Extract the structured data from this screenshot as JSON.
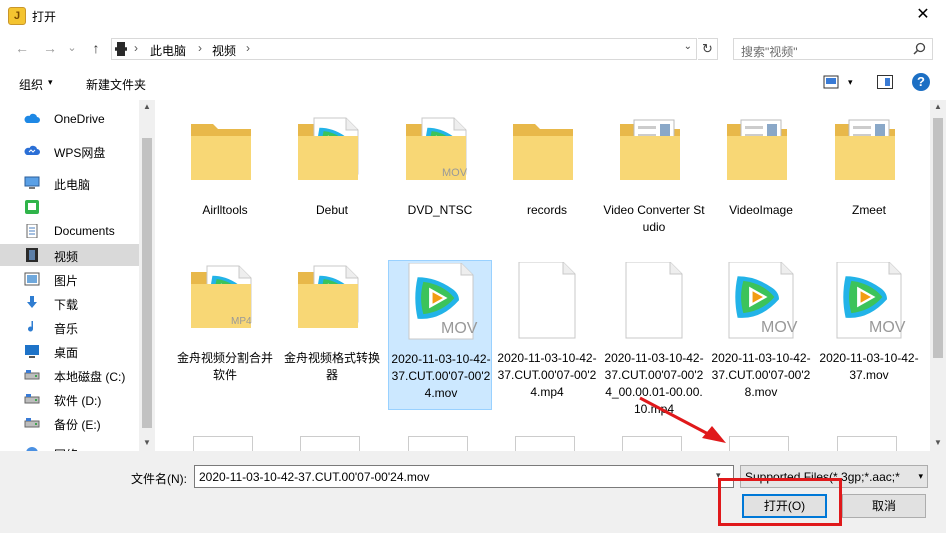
{
  "window": {
    "title": "打开",
    "close": "✕"
  },
  "nav": {
    "back": "←",
    "forward": "→",
    "dropdown": "⌄",
    "up": "↑"
  },
  "address": {
    "crumbs": [
      "此电脑",
      "视频"
    ],
    "sep": "›",
    "dropdown": "⌄",
    "refresh": "↻"
  },
  "search": {
    "placeholder": "搜索\"视频\""
  },
  "toolbar": {
    "organize": "组织",
    "caret": "▾",
    "new_folder": "新建文件夹",
    "help": "?"
  },
  "sidebar": {
    "items": [
      {
        "label": "OneDrive",
        "icon": "cloud-icon"
      },
      {
        "label": "WPS网盘",
        "icon": "wps-cloud-icon"
      },
      {
        "label": "此电脑",
        "icon": "computer-icon"
      },
      {
        "label": "",
        "icon": "green-app-icon"
      },
      {
        "label": "Documents",
        "icon": "document-icon"
      },
      {
        "label": "视频",
        "icon": "film-icon",
        "selected": true
      },
      {
        "label": "图片",
        "icon": "picture-icon"
      },
      {
        "label": "下载",
        "icon": "download-icon"
      },
      {
        "label": "音乐",
        "icon": "music-icon"
      },
      {
        "label": "桌面",
        "icon": "desktop-icon"
      },
      {
        "label": "本地磁盘 (C:)",
        "icon": "drive-icon"
      },
      {
        "label": "软件 (D:)",
        "icon": "drive-icon"
      },
      {
        "label": "备份 (E:)",
        "icon": "drive-icon"
      },
      {
        "label": "网络",
        "icon": "network-icon"
      }
    ]
  },
  "files": [
    {
      "label": "Airlltools",
      "kind": "folder"
    },
    {
      "label": "Debut",
      "kind": "folder-video"
    },
    {
      "label": "DVD_NTSC",
      "kind": "folder-mov"
    },
    {
      "label": "records",
      "kind": "folder"
    },
    {
      "label": "Video Converter Studio",
      "kind": "folder-docs"
    },
    {
      "label": "VideoImage",
      "kind": "folder-docs"
    },
    {
      "label": "Zmeet",
      "kind": "folder-docs"
    },
    {
      "label": "金舟视频分割合并软件",
      "kind": "folder-mp4"
    },
    {
      "label": "金舟视频格式转换器",
      "kind": "folder-video"
    },
    {
      "label": "2020-11-03-10-42-37.CUT.00'07-00'24.mov",
      "kind": "mov",
      "selected": true
    },
    {
      "label": "2020-11-03-10-42-37.CUT.00'07-00'24.mp4",
      "kind": "blank"
    },
    {
      "label": "2020-11-03-10-42-37.CUT.00'07-00'24_00.00.01-00.00.10.mp4",
      "kind": "blank"
    },
    {
      "label": "2020-11-03-10-42-37.CUT.00'07-00'28.mov",
      "kind": "mov"
    },
    {
      "label": "2020-11-03-10-42-37.mov",
      "kind": "mov"
    }
  ],
  "bottom": {
    "filename_label": "文件名(N):",
    "filename_value": "2020-11-03-10-42-37.CUT.00'07-00'24.mov",
    "filter": "Supported Files(*.3gp;*.aac;*",
    "open_button": "打开(O)",
    "cancel_button": "取消"
  },
  "badges": {
    "mov": "MOV",
    "mp4": "MP4"
  },
  "colors": {
    "accent": "#0078d7",
    "highlight": "#e0191b",
    "folder": "#f8d775",
    "selected_bg": "#cce8ff"
  }
}
